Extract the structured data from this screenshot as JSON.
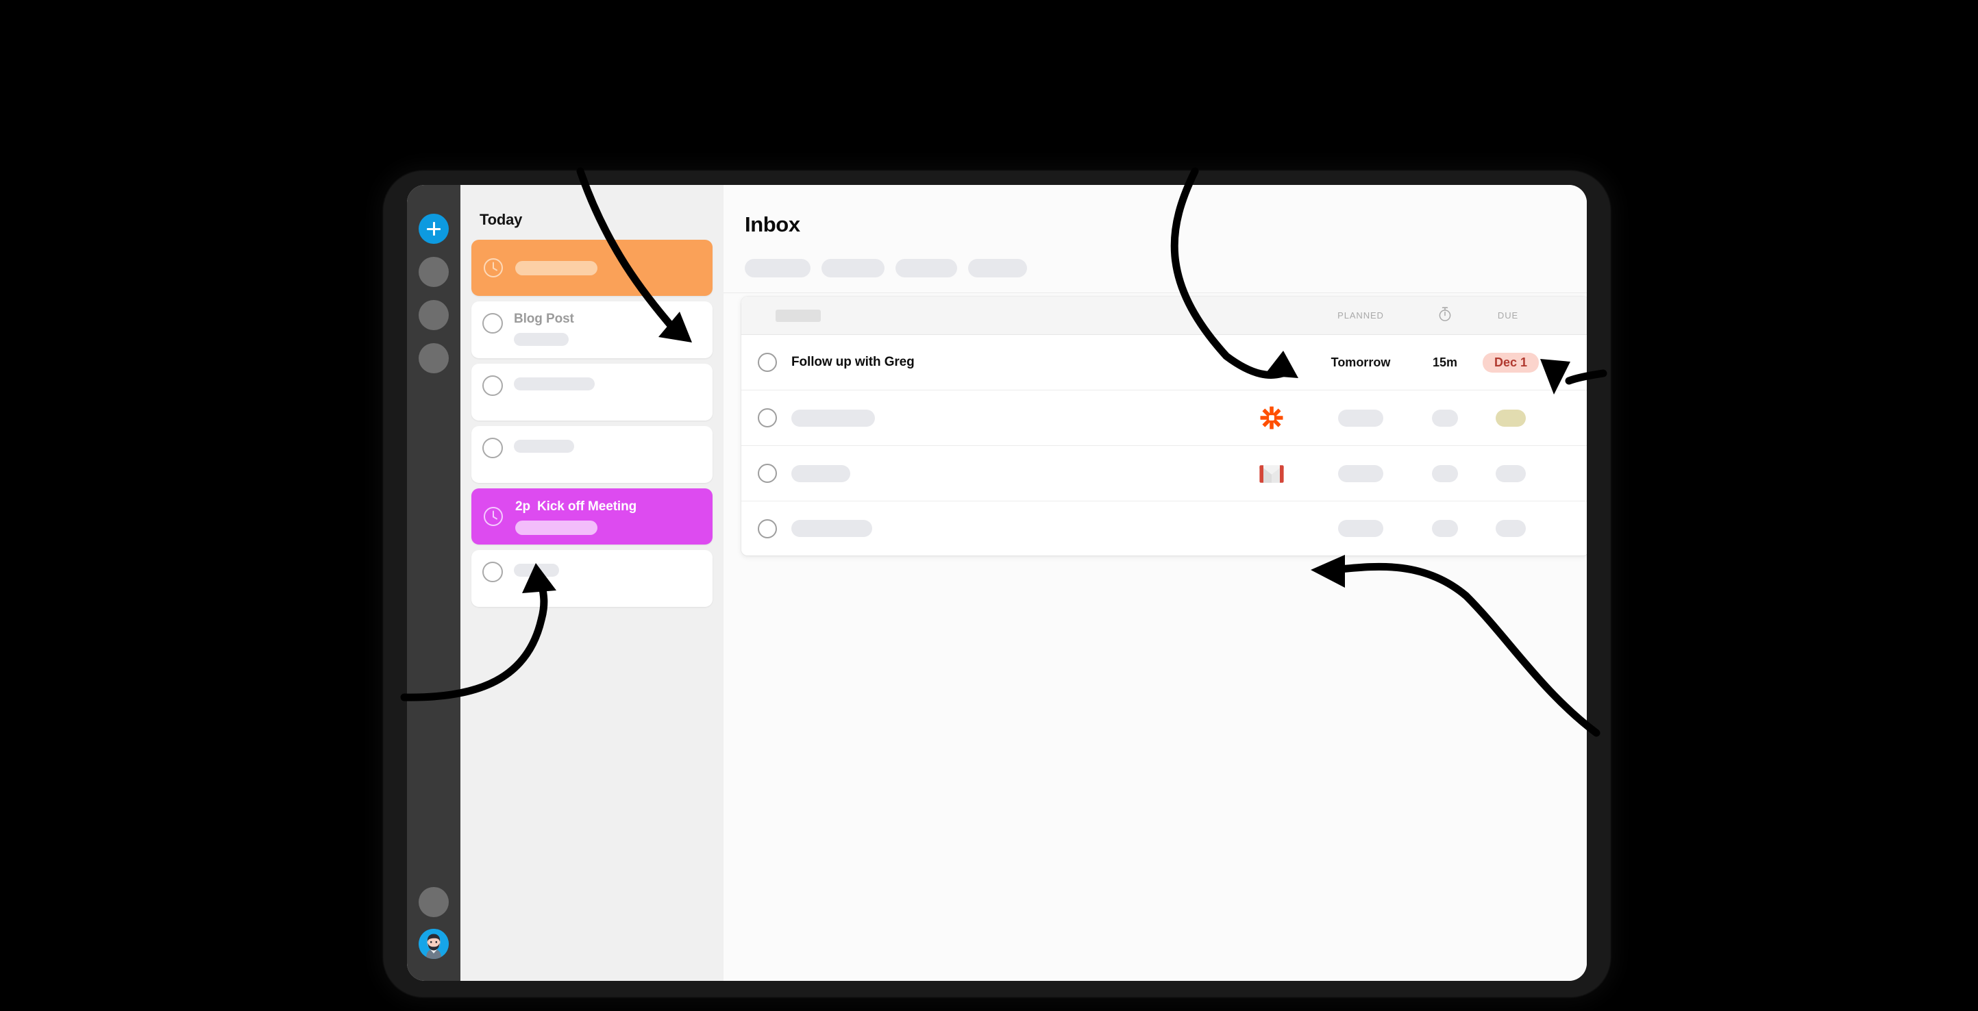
{
  "app": {
    "rail": {
      "add_button_label": "+",
      "nav_dots": [
        "nav-dot-1",
        "nav-dot-2",
        "nav-dot-3"
      ],
      "bottom_dot": "settings-dot",
      "avatar_label": "user-avatar"
    },
    "today_panel": {
      "heading": "Today",
      "cards": [
        {
          "kind": "event",
          "accent": "#faa158",
          "icon": "clock-icon",
          "title": "",
          "skeleton_width": 120
        },
        {
          "kind": "task",
          "icon": "circle-checkbox",
          "title": "Blog Post",
          "skeleton_width": 80
        },
        {
          "kind": "task",
          "icon": "circle-checkbox",
          "title": "",
          "skeleton_width": 118
        },
        {
          "kind": "task",
          "icon": "circle-checkbox",
          "title": "",
          "skeleton_width": 88
        },
        {
          "kind": "event",
          "accent": "#dd4bf0",
          "icon": "clock-icon",
          "time": "2p",
          "title": "Kick off Meeting",
          "skeleton_width": 120
        },
        {
          "kind": "task",
          "icon": "circle-checkbox",
          "title": "",
          "skeleton_width": 66
        }
      ]
    },
    "main": {
      "page_title": "Inbox",
      "filter_chips": [
        "chip-1",
        "chip-2",
        "chip-3",
        "chip-4"
      ],
      "search_pill": "search-placeholder",
      "table": {
        "columns": {
          "name": "",
          "planned": "PLANNED",
          "timer_icon": "stopwatch-icon",
          "due": "DUE"
        },
        "rows": [
          {
            "title": "Follow up with Greg",
            "app_icon": "",
            "planned": "Tomorrow",
            "timer": "15m",
            "due": "Dec 1",
            "due_style": "badge",
            "due_badge_bg": "#fbd4cc",
            "due_badge_fg": "#b0392f"
          },
          {
            "title": "",
            "title_skeleton_width": 122,
            "app_icon": "zapier-icon",
            "planned": "",
            "planned_pill": true,
            "timer": "",
            "timer_pill": true,
            "due": "",
            "due_pill": true,
            "due_pill_color": "#e2dcb0"
          },
          {
            "title": "",
            "title_skeleton_width": 86,
            "app_icon": "gmail-icon",
            "planned": "",
            "planned_pill": true,
            "timer": "",
            "timer_pill": true,
            "due": "",
            "due_pill": true,
            "due_pill_color": "#e7e8ec"
          },
          {
            "title": "",
            "title_skeleton_width": 118,
            "app_icon": "",
            "planned": "",
            "planned_pill": true,
            "timer": "",
            "timer_pill": true,
            "due": "",
            "due_pill": true,
            "due_pill_color": "#e7e8ec"
          }
        ]
      }
    },
    "colors": {
      "accent_blue": "#0d9ae0",
      "event_orange": "#faa158",
      "event_magenta": "#dd4bf0",
      "zapier_orange": "#ff4f00",
      "gmail_red": "#d44638",
      "rail_dark": "#3a3a3a",
      "due_khaki": "#e2dcb0"
    },
    "annotations": {
      "arrow_count": 4,
      "arrow_color": "#000000"
    }
  }
}
